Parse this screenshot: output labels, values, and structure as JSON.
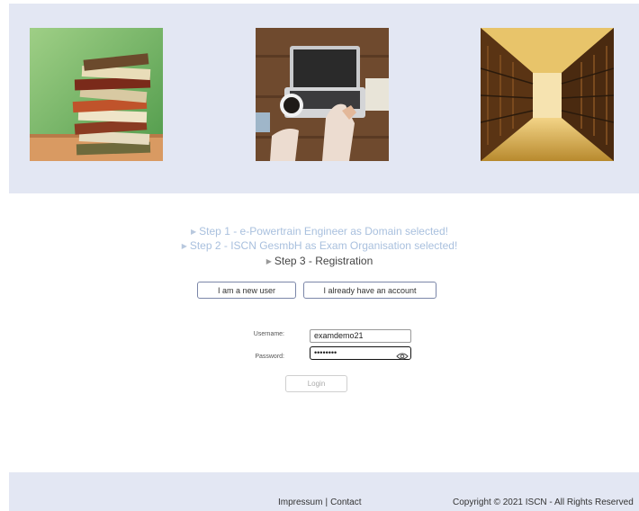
{
  "steps": {
    "step1": "Step 1 - e-Powertrain Engineer as Domain selected!",
    "step2": "Step 2 - ISCN GesmbH as Exam Organisation selected!",
    "step3": "Step 3 - Registration"
  },
  "buttons": {
    "new_user": "I am a new user",
    "existing_account": "I already have an account",
    "login": "Login"
  },
  "form": {
    "username_label": "Username:",
    "username_value": "examdemo21",
    "password_label": "Password:",
    "password_value": "••••••••"
  },
  "footer": {
    "impressum": "Impressum",
    "separator": "|",
    "contact": "Contact",
    "copyright": "Copyright © 2021 ISCN - All Rights Reserved"
  },
  "colors": {
    "hero_background": "#e3e7f3",
    "completed_step": "#a9c0de",
    "current_step": "#444444"
  },
  "icons": [
    "step-arrow-icon",
    "eye-icon"
  ]
}
